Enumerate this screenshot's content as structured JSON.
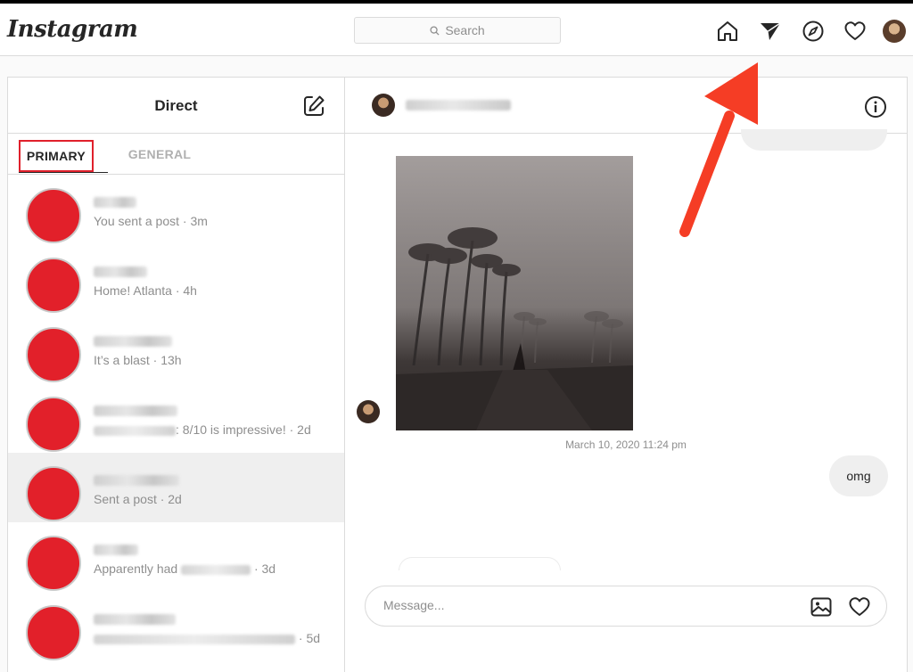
{
  "app": {
    "logo": "Instagram"
  },
  "search": {
    "placeholder": "Search"
  },
  "nav": {
    "icons": [
      "home-icon",
      "direct-icon",
      "explore-icon",
      "activity-icon",
      "profile-avatar"
    ]
  },
  "direct": {
    "title": "Direct",
    "tabs": {
      "primary": "PRIMARY",
      "general": "GENERAL"
    },
    "conversations": [
      {
        "preview": "You sent a post · 3m"
      },
      {
        "preview": "Home! Atlanta · 4h"
      },
      {
        "preview": "It’s a blast · 13h"
      },
      {
        "preview": ": 8/10 is impressive! · 2d"
      },
      {
        "preview": "Sent a post · 2d"
      },
      {
        "preview_before": "Apparently had",
        "preview_after": "· 3d"
      },
      {
        "preview": "· 5d"
      }
    ]
  },
  "chat": {
    "timestamp": "March 10, 2020 11:24 pm",
    "messages": {
      "omg": "omg"
    },
    "composer": {
      "placeholder": "Message..."
    }
  },
  "colors": {
    "highlight_box": "#e0202b",
    "arrow": "#f53d25"
  }
}
